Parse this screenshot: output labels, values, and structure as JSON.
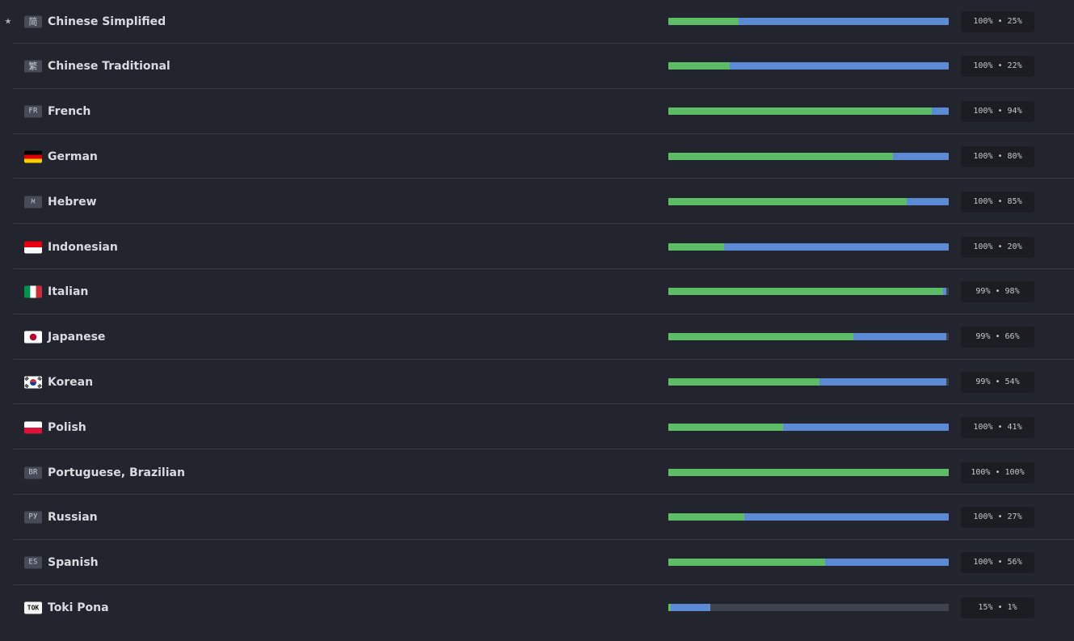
{
  "languages": [
    {
      "name": "Chinese Simplified",
      "starred": true,
      "flag": {
        "type": "badge",
        "text": "简",
        "style": "cjk"
      },
      "translated": 100,
      "approved": 25,
      "stat": "100% • 25%"
    },
    {
      "name": "Chinese Traditional",
      "starred": false,
      "flag": {
        "type": "badge",
        "text": "繁",
        "style": "cjk"
      },
      "translated": 100,
      "approved": 22,
      "stat": "100% • 22%"
    },
    {
      "name": "French",
      "starred": false,
      "flag": {
        "type": "badge",
        "text": "FR",
        "style": ""
      },
      "translated": 100,
      "approved": 94,
      "stat": "100% • 94%"
    },
    {
      "name": "German",
      "starred": false,
      "flag": {
        "type": "svg",
        "icon": "germany-flag-icon",
        "colors": [
          "#000000",
          "#dd0000",
          "#ffce00"
        ]
      },
      "translated": 100,
      "approved": 80,
      "stat": "100% • 80%"
    },
    {
      "name": "Hebrew",
      "starred": false,
      "flag": {
        "type": "badge",
        "text": "א",
        "style": ""
      },
      "translated": 100,
      "approved": 85,
      "stat": "100% • 85%"
    },
    {
      "name": "Indonesian",
      "starred": false,
      "flag": {
        "type": "svg",
        "icon": "indonesia-flag-icon",
        "colors": [
          "#e70011",
          "#ffffff"
        ]
      },
      "translated": 100,
      "approved": 20,
      "stat": "100% • 20%"
    },
    {
      "name": "Italian",
      "starred": false,
      "flag": {
        "type": "svg",
        "icon": "italy-flag-icon",
        "colors": [
          "#009246",
          "#ffffff",
          "#ce2b37"
        ]
      },
      "translated": 99,
      "approved": 98,
      "stat": "99% • 98%"
    },
    {
      "name": "Japanese",
      "starred": false,
      "flag": {
        "type": "svg",
        "icon": "japan-flag-icon",
        "colors": [
          "#ffffff",
          "#bc002d"
        ]
      },
      "translated": 99,
      "approved": 66,
      "stat": "99% • 66%"
    },
    {
      "name": "Korean",
      "starred": false,
      "flag": {
        "type": "svg",
        "icon": "korea-flag-icon",
        "colors": [
          "#ffffff",
          "#cd2e3a",
          "#0047a0",
          "#000000"
        ]
      },
      "translated": 99,
      "approved": 54,
      "stat": "99% • 54%"
    },
    {
      "name": "Polish",
      "starred": false,
      "flag": {
        "type": "svg",
        "icon": "poland-flag-icon",
        "colors": [
          "#ffffff",
          "#dc143c"
        ]
      },
      "translated": 100,
      "approved": 41,
      "stat": "100% • 41%"
    },
    {
      "name": "Portuguese, Brazilian",
      "starred": false,
      "flag": {
        "type": "badge",
        "text": "BR",
        "style": ""
      },
      "translated": 100,
      "approved": 100,
      "stat": "100% • 100%"
    },
    {
      "name": "Russian",
      "starred": false,
      "flag": {
        "type": "badge",
        "text": "РУ",
        "style": ""
      },
      "translated": 100,
      "approved": 27,
      "stat": "100% • 27%"
    },
    {
      "name": "Spanish",
      "starred": false,
      "flag": {
        "type": "badge",
        "text": "ES",
        "style": ""
      },
      "translated": 100,
      "approved": 56,
      "stat": "100% • 56%"
    },
    {
      "name": "Toki Pona",
      "starred": false,
      "flag": {
        "type": "badge",
        "text": "TOK",
        "style": "white"
      },
      "translated": 15,
      "approved": 1,
      "stat": "15% • 1%"
    }
  ],
  "star_glyph": "★",
  "colors": {
    "background": "#22252e",
    "approved": "#5dbd67",
    "translated": "#5b8bd4",
    "untranslated": "#3e4350",
    "stat_bg": "#1b1d23"
  }
}
